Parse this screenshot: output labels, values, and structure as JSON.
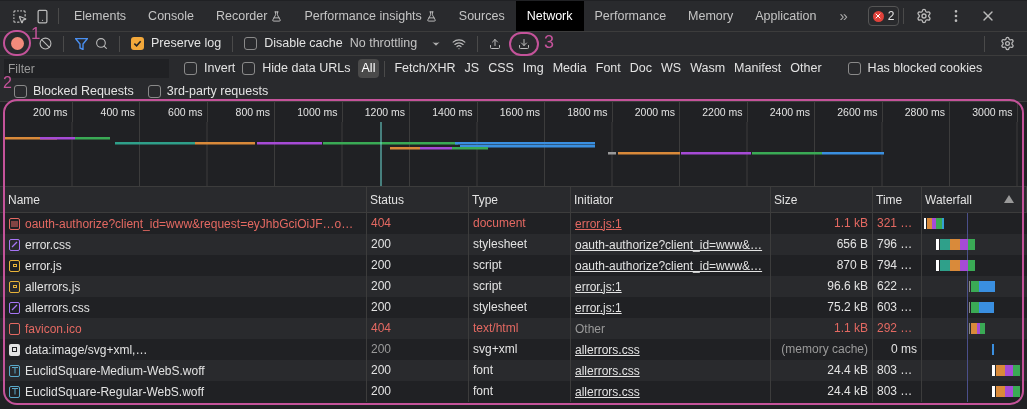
{
  "tabs": [
    {
      "label": "Elements",
      "selected": false,
      "experimental": false
    },
    {
      "label": "Console",
      "selected": false,
      "experimental": false
    },
    {
      "label": "Recorder",
      "selected": false,
      "experimental": true
    },
    {
      "label": "Performance insights",
      "selected": false,
      "experimental": true
    },
    {
      "label": "Sources",
      "selected": false,
      "experimental": false
    },
    {
      "label": "Network",
      "selected": true,
      "experimental": false
    },
    {
      "label": "Performance",
      "selected": false,
      "experimental": false
    },
    {
      "label": "Memory",
      "selected": false,
      "experimental": false
    },
    {
      "label": "Application",
      "selected": false,
      "experimental": false
    }
  ],
  "more_tabs": "»",
  "error_badge": "2",
  "toolbar": {
    "recording": true,
    "checkboxes": [
      {
        "label": "Preserve log",
        "checked": true
      },
      {
        "label": "Disable cache",
        "checked": false
      }
    ],
    "throttling": "No throttling"
  },
  "filter": {
    "placeholder": "Filter",
    "checkboxes": [
      {
        "label": "Invert",
        "checked": false
      },
      {
        "label": "Hide data URLs",
        "checked": false
      }
    ],
    "types": [
      {
        "label": "All",
        "selected": true
      },
      {
        "label": "Fetch/XHR",
        "selected": false
      },
      {
        "label": "JS",
        "selected": false
      },
      {
        "label": "CSS",
        "selected": false
      },
      {
        "label": "Img",
        "selected": false
      },
      {
        "label": "Media",
        "selected": false
      },
      {
        "label": "Font",
        "selected": false
      },
      {
        "label": "Doc",
        "selected": false
      },
      {
        "label": "WS",
        "selected": false
      },
      {
        "label": "Wasm",
        "selected": false
      },
      {
        "label": "Manifest",
        "selected": false
      },
      {
        "label": "Other",
        "selected": false
      }
    ],
    "blocked_cookies": {
      "label": "Has blocked cookies",
      "checked": false
    },
    "more_checkboxes": [
      {
        "label": "Blocked Requests",
        "checked": false
      },
      {
        "label": "3rd-party requests",
        "checked": false
      }
    ]
  },
  "overview": {
    "ticks": [
      "200 ms",
      "400 ms",
      "600 ms",
      "800 ms",
      "1000 ms",
      "1200 ms",
      "1400 ms",
      "1600 ms",
      "1800 ms",
      "2000 ms",
      "2200 ms",
      "2400 ms",
      "2600 ms",
      "2800 ms",
      "3000 ms"
    ]
  },
  "table": {
    "columns": [
      "Name",
      "Status",
      "Type",
      "Initiator",
      "Size",
      "Time",
      "Waterfall"
    ],
    "rows": [
      {
        "kind": "document",
        "name": "oauth-authorize?client_id=www&request=eyJhbGciOiJF…o…",
        "status": "404",
        "type": "document",
        "initiator": "error.js:1",
        "initiator_link": true,
        "size": "1.1 kB",
        "time": "321 …",
        "error": true,
        "cached": false
      },
      {
        "kind": "stylesheet",
        "name": "error.css",
        "status": "200",
        "type": "stylesheet",
        "initiator": "oauth-authorize?client_id=www&…",
        "initiator_link": true,
        "size": "656 B",
        "time": "796 …",
        "error": false,
        "cached": false
      },
      {
        "kind": "script",
        "name": "error.js",
        "status": "200",
        "type": "script",
        "initiator": "oauth-authorize?client_id=www&…",
        "initiator_link": true,
        "size": "870 B",
        "time": "794 …",
        "error": false,
        "cached": false
      },
      {
        "kind": "script",
        "name": "allerrors.js",
        "status": "200",
        "type": "script",
        "initiator": "error.js:1",
        "initiator_link": true,
        "size": "96.6 kB",
        "time": "622 …",
        "error": false,
        "cached": false
      },
      {
        "kind": "stylesheet",
        "name": "allerrors.css",
        "status": "200",
        "type": "stylesheet",
        "initiator": "error.js:1",
        "initiator_link": true,
        "size": "75.2 kB",
        "time": "603 …",
        "error": false,
        "cached": false
      },
      {
        "kind": "other",
        "name": "favicon.ico",
        "status": "404",
        "type": "text/html",
        "initiator": "Other",
        "initiator_link": false,
        "size": "1.1 kB",
        "time": "292 …",
        "error": true,
        "cached": false
      },
      {
        "kind": "image",
        "name": "data:image/svg+xml,…",
        "status": "200",
        "type": "svg+xml",
        "initiator": "allerrors.css",
        "initiator_link": true,
        "size": "(memory cache)",
        "time": "0 ms",
        "error": false,
        "cached": true
      },
      {
        "kind": "font",
        "name": "EuclidSquare-Medium-WebS.woff",
        "status": "200",
        "type": "font",
        "initiator": "allerrors.css",
        "initiator_link": true,
        "size": "24.4 kB",
        "time": "803 …",
        "error": false,
        "cached": false
      },
      {
        "kind": "font",
        "name": "EuclidSquare-Regular-WebS.woff",
        "status": "200",
        "type": "font",
        "initiator": "allerrors.css",
        "initiator_link": true,
        "size": "24.4 kB",
        "time": "803 …",
        "error": false,
        "cached": false
      }
    ]
  },
  "annotations": [
    "1",
    "2",
    "3"
  ]
}
